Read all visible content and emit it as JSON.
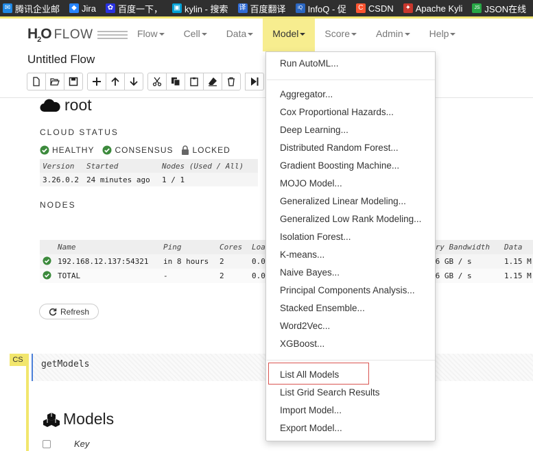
{
  "bookmarks": [
    {
      "label": "腾讯企业邮",
      "icon": "mail-icon",
      "color": "#1e88e5"
    },
    {
      "label": "Jira",
      "icon": "jira-icon",
      "color": "#2684ff"
    },
    {
      "label": "百度一下，",
      "icon": "baidu-icon",
      "color": "#2932e1"
    },
    {
      "label": "kylin - 搜索",
      "icon": "bilibili-icon",
      "color": "#00a1d6"
    },
    {
      "label": "百度翻译",
      "icon": "translate-icon",
      "color": "#2f6bd6"
    },
    {
      "label": "InfoQ - 促",
      "icon": "infoq-icon",
      "color": "#2a66c1"
    },
    {
      "label": "CSDN",
      "icon": "csdn-icon",
      "color": "#fc5531"
    },
    {
      "label": "Apache Kyli",
      "icon": "apache-icon",
      "color": "#c8372d"
    },
    {
      "label": "JSON在线",
      "icon": "json-icon",
      "color": "#28a745"
    }
  ],
  "logo": {
    "h2o": "H",
    "h2o_sub": "2",
    "h2o_o": "O",
    "flow": "FLOW"
  },
  "nav": [
    {
      "label": "Flow",
      "active": false
    },
    {
      "label": "Cell",
      "active": false
    },
    {
      "label": "Data",
      "active": false
    },
    {
      "label": "Model",
      "active": true
    },
    {
      "label": "Score",
      "active": false
    },
    {
      "label": "Admin",
      "active": false
    },
    {
      "label": "Help",
      "active": false
    }
  ],
  "flow_title": "Untitled Flow",
  "cloud": {
    "title": "root",
    "status_heading": "CLOUD STATUS",
    "statuses": [
      "HEALTHY",
      "CONSENSUS",
      "LOCKED"
    ],
    "table_headers": [
      "Version",
      "Started",
      "Nodes (Used / All)"
    ],
    "table_row": [
      "3.26.0.2",
      "24 minutes ago",
      "1 / 1"
    ],
    "nodes_heading": "NODES",
    "nodes_headers": [
      "Name",
      "Ping",
      "Cores",
      "Loa",
      "ory Bandwidth",
      "Data"
    ],
    "nodes_rows": [
      [
        "192.168.12.137:54321",
        "in 8 hours",
        "2",
        "0.0",
        ".6 GB / s",
        "1.15 M"
      ],
      [
        "TOTAL",
        "-",
        "2",
        "0.0",
        ".6 GB / s",
        "1.15 M"
      ]
    ],
    "refresh_label": "Refresh"
  },
  "cell": {
    "tag": "CS",
    "code": "getModels"
  },
  "models": {
    "title": "Models",
    "key_header": "Key"
  },
  "model_menu": {
    "top": [
      "Run AutoML..."
    ],
    "algorithms": [
      "Aggregator...",
      "Cox Proportional Hazards...",
      "Deep Learning...",
      "Distributed Random Forest...",
      "Gradient Boosting Machine...",
      "MOJO Model...",
      "Generalized Linear Modeling...",
      "Generalized Low Rank Modeling...",
      "Isolation Forest...",
      "K-means...",
      "Naive Bayes...",
      "Principal Components Analysis...",
      "Stacked Ensemble...",
      "Word2Vec...",
      "XGBoost..."
    ],
    "bottom": [
      "List All Models",
      "List Grid Search Results",
      "Import Model...",
      "Export Model..."
    ]
  },
  "colors": {
    "accent": "#f7ed8f",
    "ok": "#3c8a3c",
    "highlight": "#d9534f",
    "cell_border": "#4a7fd8"
  }
}
